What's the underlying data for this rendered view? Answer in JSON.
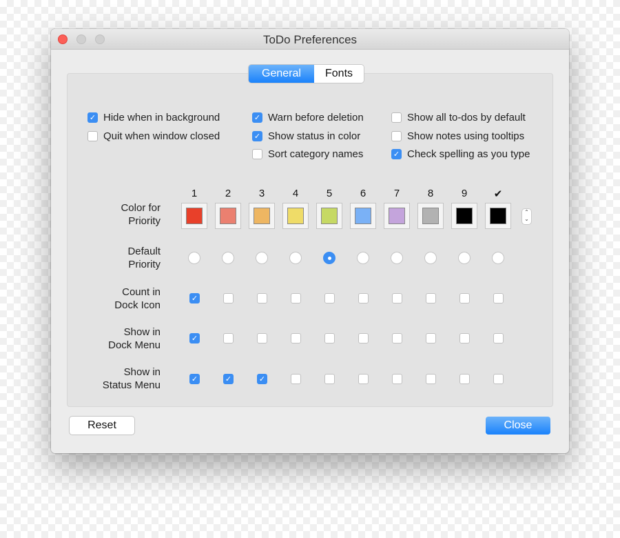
{
  "window": {
    "title": "ToDo Preferences"
  },
  "tabs": [
    {
      "label": "General",
      "active": true
    },
    {
      "label": "Fonts",
      "active": false
    }
  ],
  "options": [
    {
      "label": "Hide when in background",
      "checked": true
    },
    {
      "label": "Quit when window closed",
      "checked": false
    },
    {
      "label": "Warn before deletion",
      "checked": true
    },
    {
      "label": "Show status in color",
      "checked": true
    },
    {
      "label": "Sort category names",
      "checked": false
    },
    {
      "label": "Show all to-dos by default",
      "checked": false
    },
    {
      "label": "Show notes using tooltips",
      "checked": false
    },
    {
      "label": "Check spelling as you type",
      "checked": true
    }
  ],
  "priority_columns": [
    "1",
    "2",
    "3",
    "4",
    "5",
    "6",
    "7",
    "8",
    "9",
    "✔"
  ],
  "colors": [
    "#e8402a",
    "#eb8070",
    "#eeb662",
    "#efdc68",
    "#c6d964",
    "#7ab1f6",
    "#c4a4dc",
    "#b2b2b2",
    "#000000",
    "#000000"
  ],
  "rows": {
    "color": "Color for\nPriority",
    "default": "Default\nPriority",
    "count": "Count in\nDock Icon",
    "dockmenu": "Show in\nDock Menu",
    "statusmenu": "Show in\nStatus Menu"
  },
  "default_priority_index": 4,
  "count_in_dock_icon": [
    true,
    false,
    false,
    false,
    false,
    false,
    false,
    false,
    false,
    false
  ],
  "show_in_dock_menu": [
    true,
    false,
    false,
    false,
    false,
    false,
    false,
    false,
    false,
    false
  ],
  "show_in_status_menu": [
    true,
    true,
    true,
    false,
    false,
    false,
    false,
    false,
    false,
    false
  ],
  "buttons": {
    "reset": "Reset",
    "close": "Close"
  },
  "accent": "#3b8ef3"
}
